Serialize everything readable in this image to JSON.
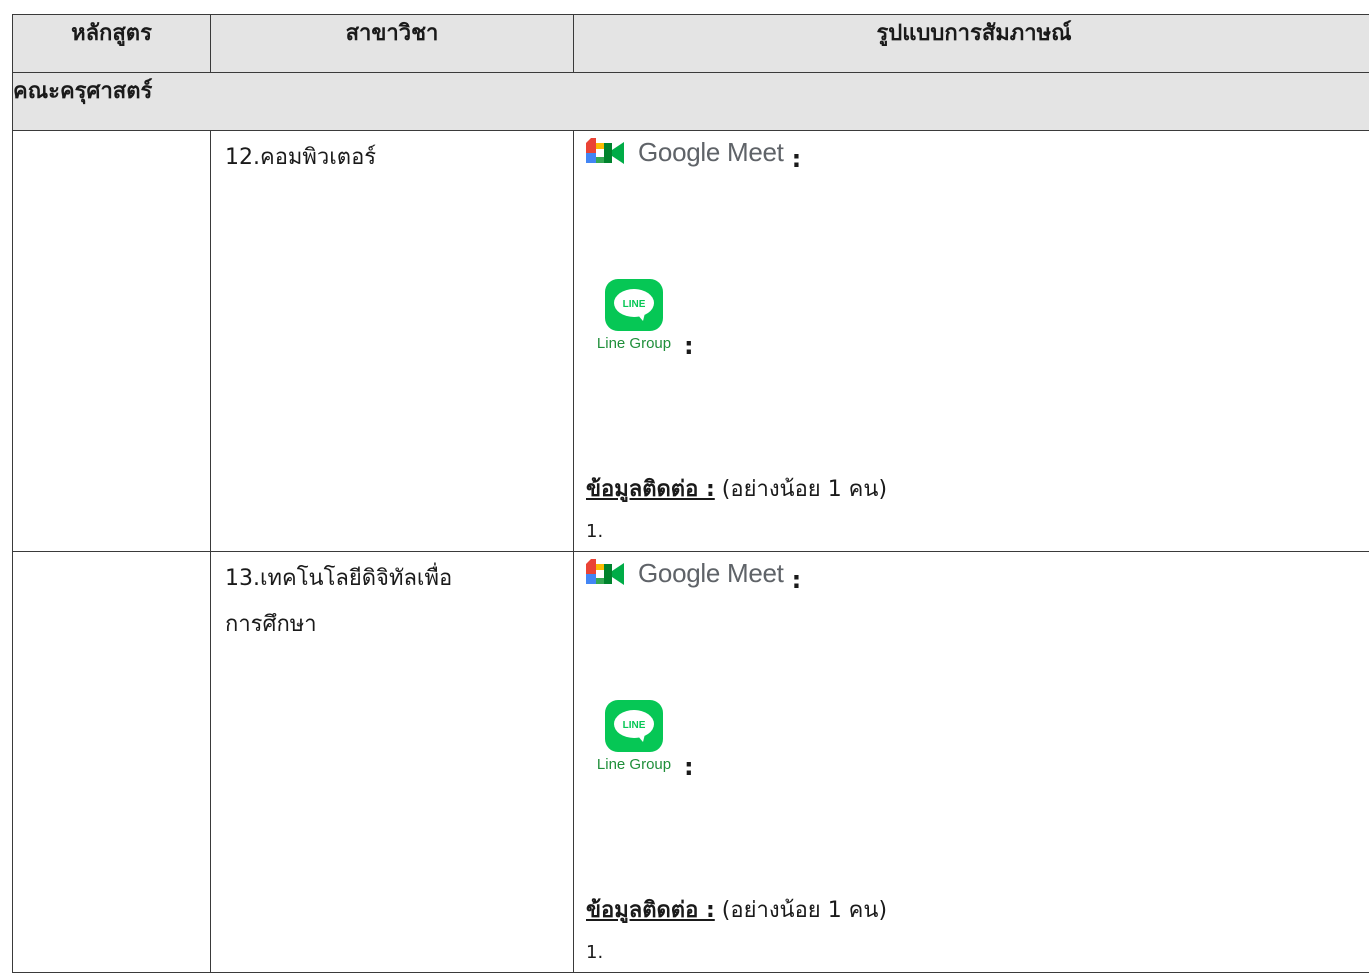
{
  "header": {
    "col_program": "หลักสูตร",
    "col_major": "สาขาวิชา",
    "col_interview": "รูปแบบการสัมภาษณ์"
  },
  "faculty": "คณะครุศาสตร์",
  "rows": [
    {
      "major": "12.คอมพิวเตอร์",
      "google_meet_label": "Google Meet",
      "google_meet_colon": ":",
      "line_label": "Line Group",
      "line_colon": ":",
      "line_badge_text": "LINE",
      "contact_label": "ข้อมูลติดต่อ :",
      "contact_note": " (อย่างน้อย 1 คน)",
      "contact_item": "1."
    },
    {
      "major_line1": "13.เทคโนโลยีดิจิทัลเพื่อ",
      "major_line2": "การศึกษา",
      "google_meet_label": "Google Meet",
      "google_meet_colon": ":",
      "line_label": "Line Group",
      "line_colon": ":",
      "line_badge_text": "LINE",
      "contact_label": "ข้อมูลติดต่อ :",
      "contact_note": " (อย่างน้อย 1 คน)",
      "contact_item": "1."
    }
  ],
  "colors": {
    "header_bg": "#e4e4e4",
    "line_green": "#06c755",
    "border": "#3a3a3a"
  }
}
